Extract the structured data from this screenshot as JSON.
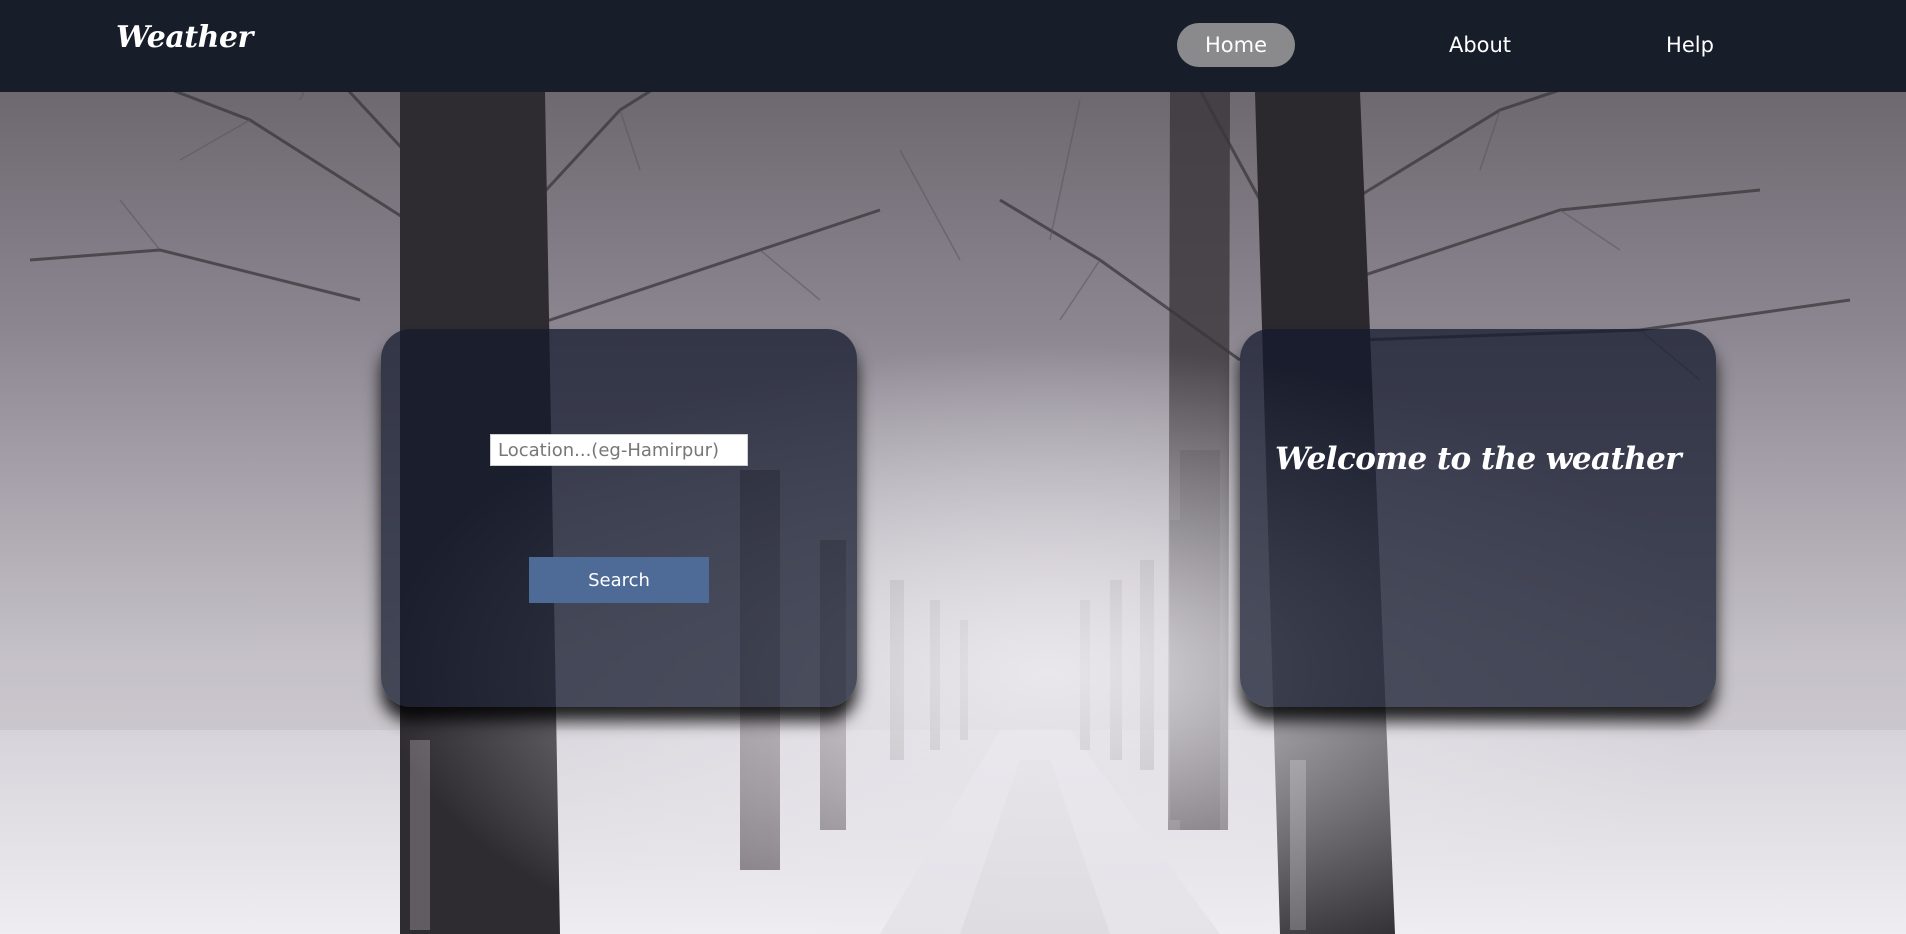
{
  "navbar": {
    "brand": "Weather",
    "links": [
      {
        "label": "Home",
        "active": true
      },
      {
        "label": "About",
        "active": false
      },
      {
        "label": "Help",
        "active": false
      }
    ]
  },
  "search_card": {
    "location_placeholder": "Location...(eg-Hamirpur)",
    "location_value": "",
    "search_label": "Search"
  },
  "welcome_card": {
    "message": "Welcome to the weather"
  },
  "colors": {
    "navbar_bg": "#171d29",
    "active_nav_bg": "#8a8a8c",
    "search_button_bg": "#4d6b96",
    "card_bg": "#14192d"
  },
  "background": {
    "scene": "snowy tree-lined path in fog"
  }
}
